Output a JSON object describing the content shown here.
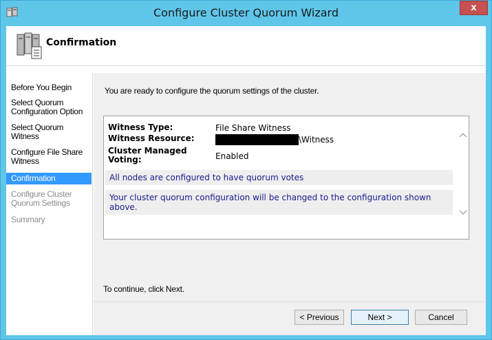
{
  "window": {
    "title": "Configure Cluster Quorum Wizard",
    "close_label": "x"
  },
  "header": {
    "title": "Confirmation",
    "icon": "cluster-wizard-icon"
  },
  "sidebar": {
    "items": [
      {
        "label": "Before You Begin",
        "state": "normal"
      },
      {
        "label": "Select Quorum Configuration Option",
        "state": "normal"
      },
      {
        "label": "Select Quorum Witness",
        "state": "normal"
      },
      {
        "label": "Configure File Share Witness",
        "state": "normal"
      },
      {
        "label": "Confirmation",
        "state": "active"
      },
      {
        "label": "Configure Cluster Quorum Settings",
        "state": "disabled"
      },
      {
        "label": "Summary",
        "state": "disabled"
      }
    ]
  },
  "main": {
    "intro": "You are ready to configure the quorum settings of the cluster.",
    "summary": {
      "rows": [
        {
          "label": "Witness Type:",
          "value": "File Share Witness"
        },
        {
          "label": "Witness Resource:",
          "value": "\\Witness"
        },
        {
          "label": "Cluster Managed Voting:",
          "value": "Enabled"
        }
      ],
      "notes": [
        "All nodes are configured to have quorum votes",
        "Your cluster quorum configuration will be changed to the configuration shown above."
      ]
    },
    "continue_text": "To continue, click Next."
  },
  "buttons": {
    "previous": "< Previous",
    "next": "Next >",
    "cancel": "Cancel"
  }
}
